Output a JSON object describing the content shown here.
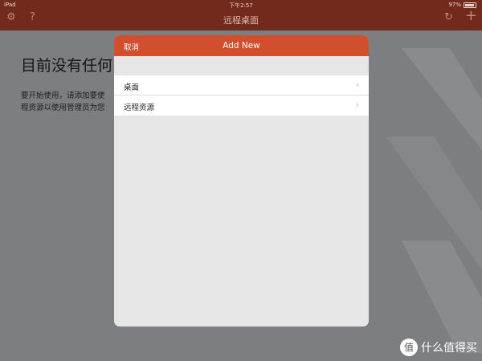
{
  "status_bar": {
    "carrier": "iPad",
    "time": "下午2:57",
    "battery": "97%"
  },
  "nav": {
    "title": "远程桌面",
    "icons": [
      "gear-icon",
      "help-icon",
      "refresh-icon",
      "plus-icon"
    ]
  },
  "background": {
    "heading": "目前没有任何",
    "body_line1": "要开始使用，请添加要使",
    "body_line2": "程资源以使用管理员为您"
  },
  "modal": {
    "cancel_label": "取消",
    "title": "Add New",
    "items": [
      {
        "label": "桌面"
      },
      {
        "label": "远程资源"
      }
    ]
  },
  "watermark": {
    "text": "什么值得买",
    "logo_glyph": "值"
  },
  "colors": {
    "nav_bg": "#722a1d",
    "modal_header": "#d14f2d",
    "backdrop": "#7d7e82"
  }
}
